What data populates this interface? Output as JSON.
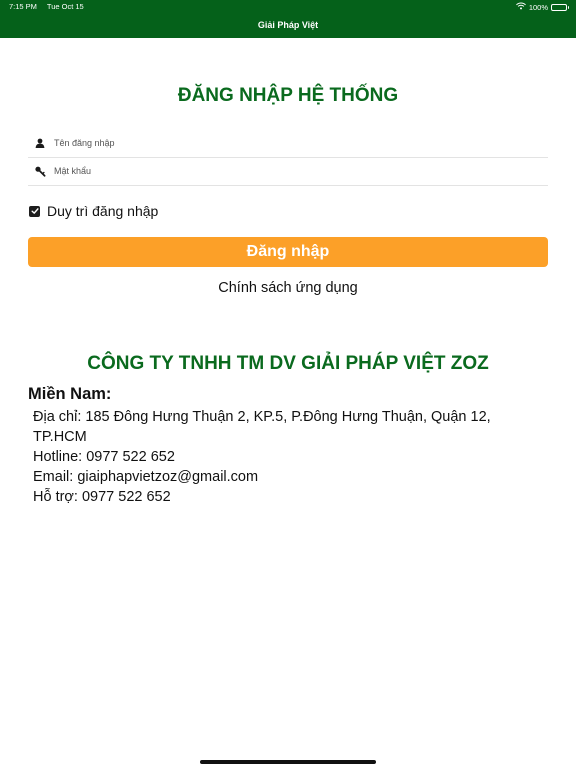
{
  "status_bar": {
    "time": "7:15 PM",
    "date": "Tue Oct 15",
    "battery": "100%",
    "battery_level": 1.0
  },
  "nav": {
    "title": "Giải Pháp Việt"
  },
  "login": {
    "title": "ĐĂNG NHẬP HỆ THỐNG",
    "username_placeholder": "Tên đăng nhập",
    "password_placeholder": "Mật khẩu",
    "remember_label": "Duy trì đăng nhập",
    "remember_checked": true,
    "submit_label": "Đăng nhập",
    "policy_label": "Chính sách ứng dụng"
  },
  "company": {
    "name": "CÔNG TY TNHH TM DV GIẢI PHÁP VIỆT ZOZ",
    "region": "Miền Nam:",
    "address": "Địa chỉ: 185 Đông Hưng Thuận 2, KP.5, P.Đông Hưng Thuận, Quận 12, TP.HCM",
    "hotline": "Hotline: 0977 522 652",
    "email": "Email: giaiphapvietzoz@gmail.com",
    "support": "Hỗ trợ: 0977 522 652"
  },
  "colors": {
    "header_bg": "#05611a",
    "title_green": "#0a6a1e",
    "button_orange": "#fca028"
  },
  "icons": {
    "username": "person-icon",
    "password": "key-icon",
    "wifi": "wifi-icon",
    "battery": "battery-icon"
  }
}
